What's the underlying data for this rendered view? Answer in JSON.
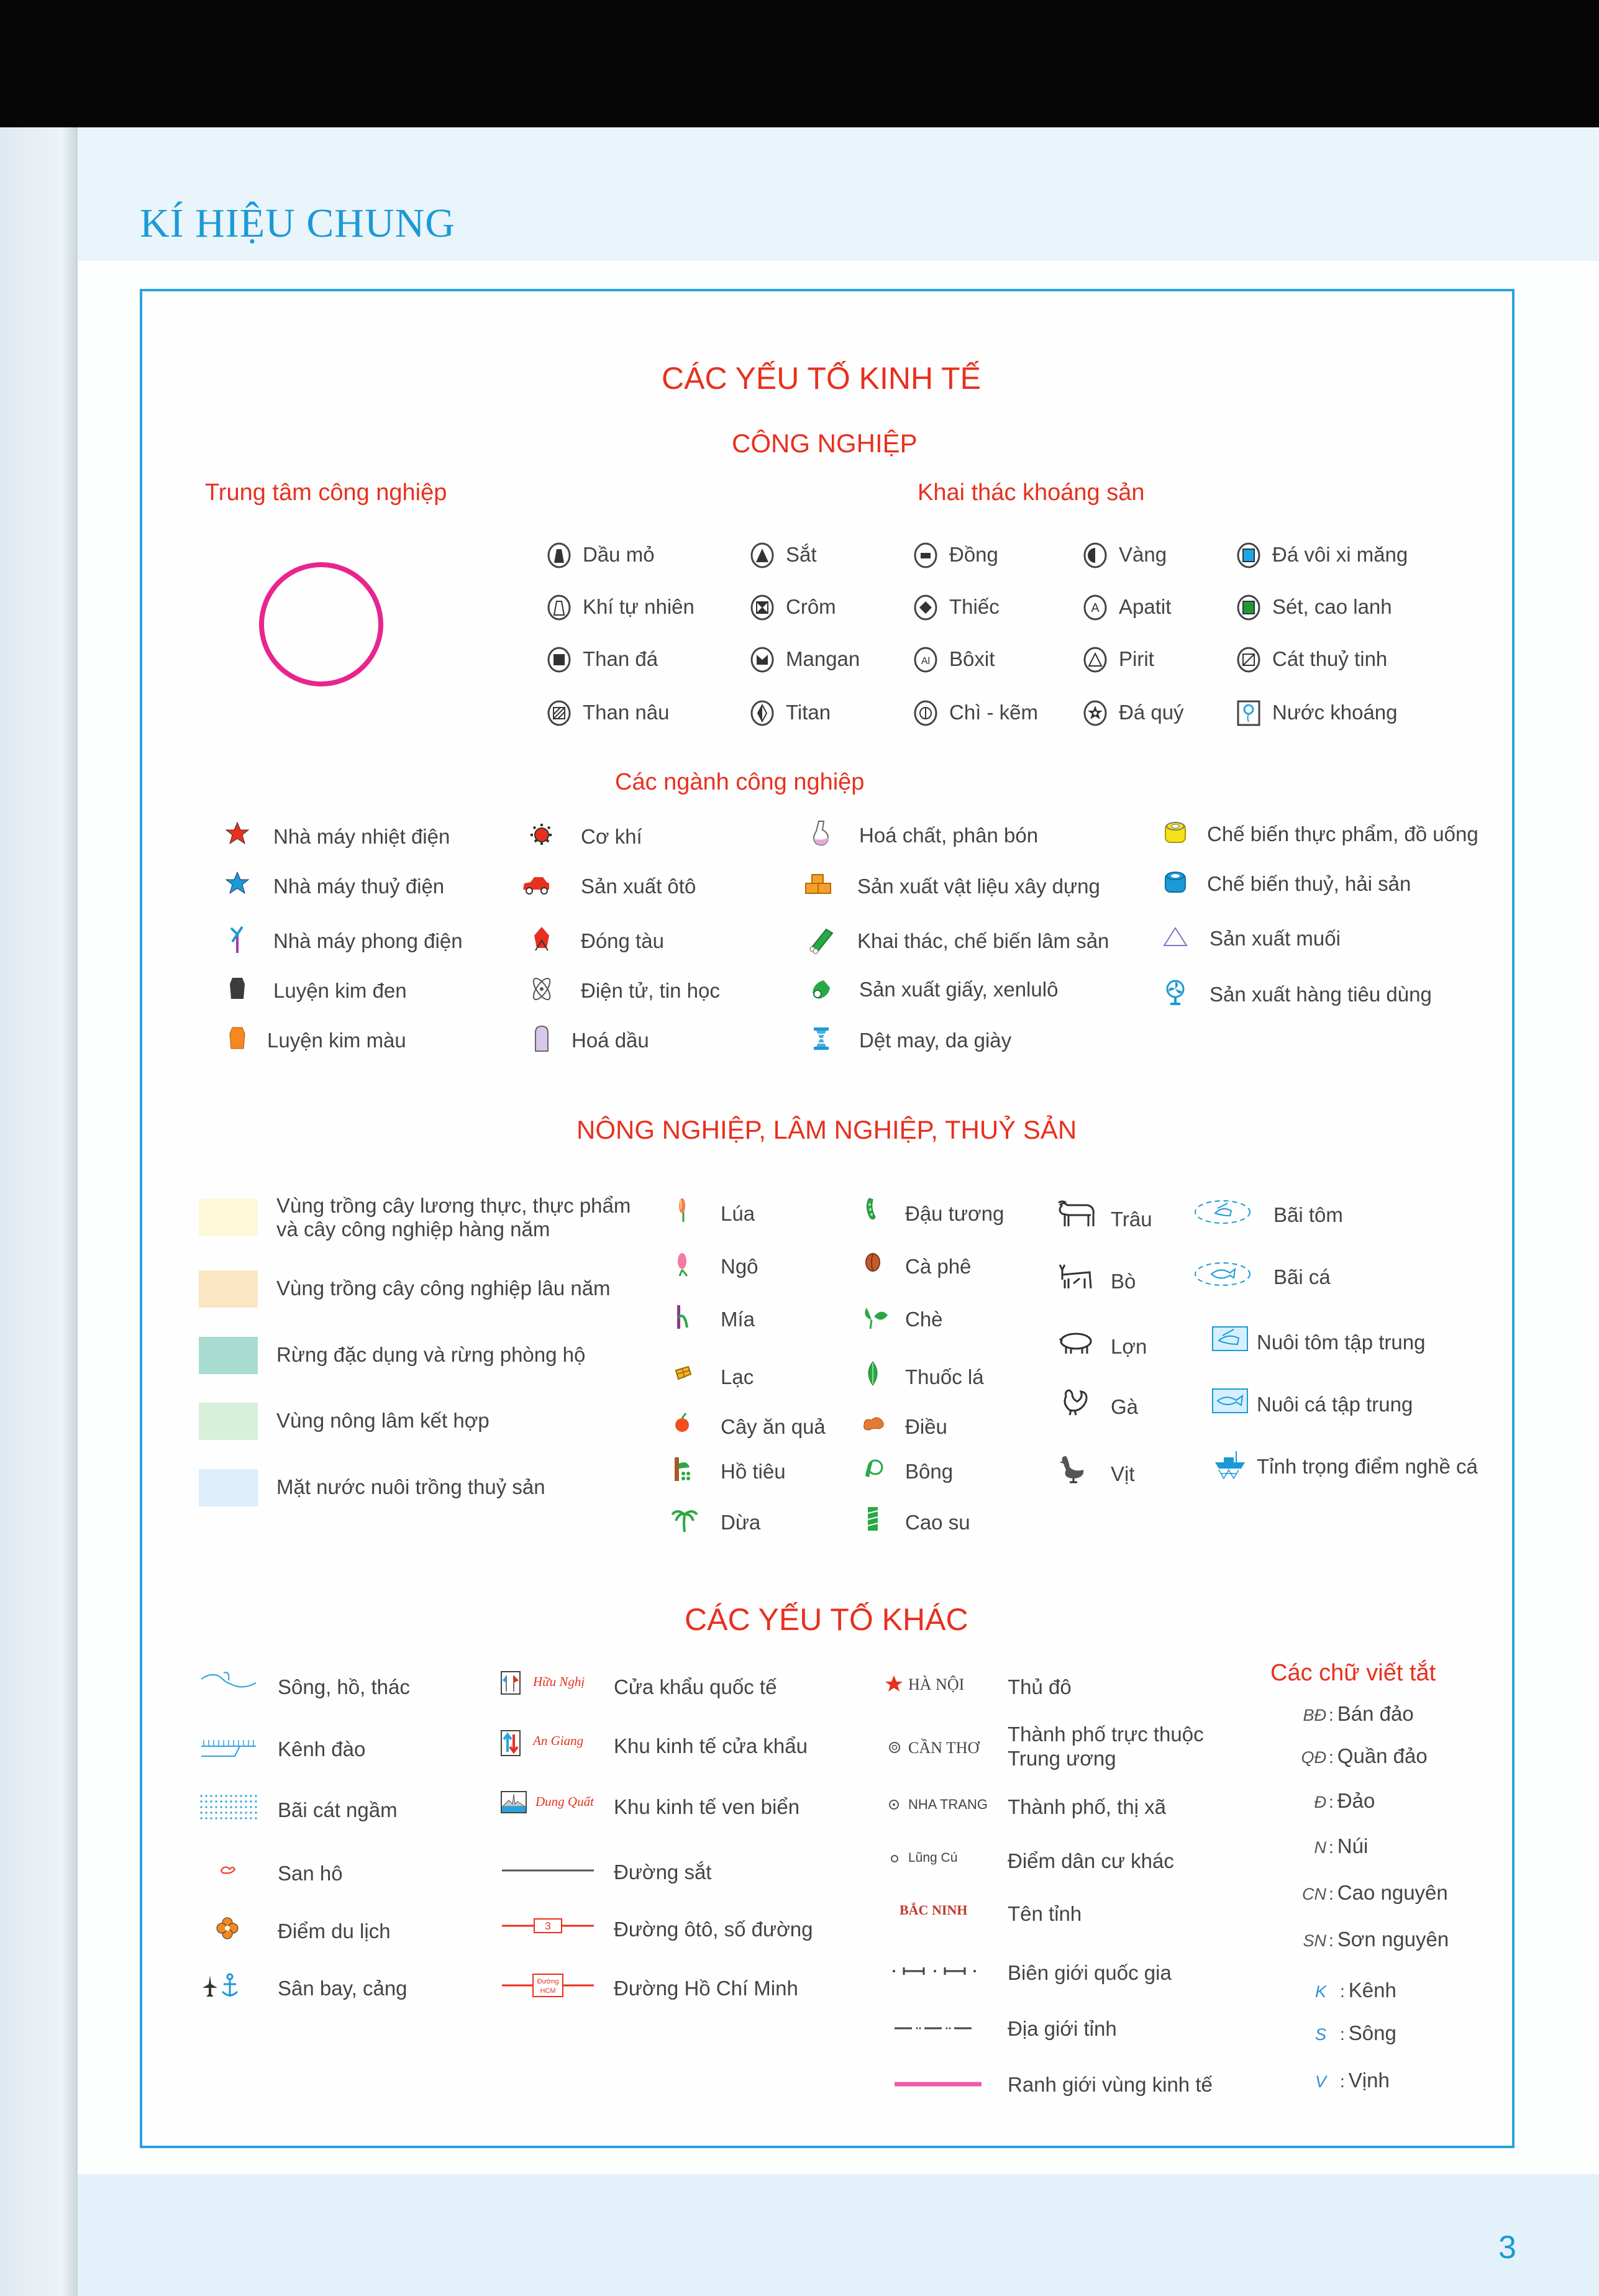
{
  "page": {
    "title": "KÍ HIỆU CHUNG",
    "page_number": "3"
  },
  "economy": {
    "heading": "CÁC YẾU TỐ KINH TẾ",
    "industry": {
      "heading": "CÔNG NGHIỆP",
      "center_label": "Trung tâm công nghiệp",
      "center_color": "#e8258f",
      "minerals_heading": "Khai thác khoáng sản",
      "minerals": [
        {
          "label": "Dầu mỏ",
          "icon": "oil-icon"
        },
        {
          "label": "Khí tự nhiên",
          "icon": "natural-gas-icon"
        },
        {
          "label": "Than đá",
          "icon": "coal-icon"
        },
        {
          "label": "Than nâu",
          "icon": "lignite-icon"
        },
        {
          "label": "Sắt",
          "icon": "iron-icon"
        },
        {
          "label": "Crôm",
          "icon": "chromium-icon"
        },
        {
          "label": "Mangan",
          "icon": "manganese-icon"
        },
        {
          "label": "Titan",
          "icon": "titanium-icon"
        },
        {
          "label": "Đồng",
          "icon": "copper-icon"
        },
        {
          "label": "Thiếc",
          "icon": "tin-icon"
        },
        {
          "label": "Bôxit",
          "icon": "bauxite-icon",
          "glyph": "Al"
        },
        {
          "label": "Chì - kẽm",
          "icon": "lead-zinc-icon"
        },
        {
          "label": "Vàng",
          "icon": "gold-icon"
        },
        {
          "label": "Apatit",
          "icon": "apatite-icon",
          "glyph": "A"
        },
        {
          "label": "Pirit",
          "icon": "pyrite-icon"
        },
        {
          "label": "Đá quý",
          "icon": "gemstone-icon"
        },
        {
          "label": "Đá vôi xi măng",
          "icon": "limestone-icon",
          "color": "#1aa7e6"
        },
        {
          "label": "Sét, cao lanh",
          "icon": "clay-kaolin-icon",
          "color": "#1e9a3a"
        },
        {
          "label": "Cát thuỷ tinh",
          "icon": "glass-sand-icon"
        },
        {
          "label": "Nước khoáng",
          "icon": "mineral-water-icon"
        }
      ],
      "sectors_heading": "Các ngành công nghiệp",
      "sectors": [
        {
          "label": "Nhà máy nhiệt điện",
          "icon": "thermal-power-icon",
          "color": "#e8301e"
        },
        {
          "label": "Nhà máy thuỷ điện",
          "icon": "hydro-power-icon",
          "color": "#1a9ad6"
        },
        {
          "label": "Nhà máy phong điện",
          "icon": "wind-power-icon",
          "color": "#a43ba0"
        },
        {
          "label": "Luyện kim đen",
          "icon": "ferrous-metallurgy-icon",
          "color": "#3c3c3c"
        },
        {
          "label": "Luyện kim màu",
          "icon": "nonferrous-metallurgy-icon",
          "color": "#f5881f"
        },
        {
          "label": "Cơ khí",
          "icon": "mechanical-icon",
          "color": "#e8301e"
        },
        {
          "label": "Sản xuất ôtô",
          "icon": "car-icon",
          "color": "#e8301e"
        },
        {
          "label": "Đóng tàu",
          "icon": "shipbuilding-icon",
          "color": "#e8301e"
        },
        {
          "label": "Điện tử, tin học",
          "icon": "electronics-icon",
          "color": "#555555"
        },
        {
          "label": "Hoá dầu",
          "icon": "petrochemical-icon",
          "color": "#d9c7ec"
        },
        {
          "label": "Hoá chất, phân bón",
          "icon": "chemical-flask-icon",
          "color": "#e6a9dd"
        },
        {
          "label": "Sản xuất vật liệu xây dựng",
          "icon": "bricks-icon",
          "color": "#f5a02c"
        },
        {
          "label": "Khai thác, chế biến lâm sản",
          "icon": "timber-icon",
          "color": "#2aa845"
        },
        {
          "label": "Sản xuất giấy, xenlulô",
          "icon": "paper-roll-icon",
          "color": "#2aa845"
        },
        {
          "label": "Dệt may, da giày",
          "icon": "textile-spool-icon",
          "color": "#1a9ad6"
        },
        {
          "label": "Chế biến thực phẩm, đồ uống",
          "icon": "food-can-icon",
          "color": "#f4e21a"
        },
        {
          "label": "Chế biến thuỷ, hải sản",
          "icon": "seafood-can-icon",
          "color": "#1a9ad6"
        },
        {
          "label": "Sản xuất muối",
          "icon": "salt-triangle-icon",
          "color": "#8a70c8"
        },
        {
          "label": "Sản xuất hàng tiêu dùng",
          "icon": "fan-icon",
          "color": "#1a9ad6"
        }
      ]
    },
    "agriculture": {
      "heading": "NÔNG NGHIỆP, LÂM NGHIỆP, THUỶ SẢN",
      "zones": [
        {
          "label_line1": "Vùng trồng cây lương thực, thực phẩm",
          "label_line2": "và cây công nghiệp hàng năm",
          "color": "#fdf8d8"
        },
        {
          "label_line1": "Vùng trồng cây công nghiệp lâu năm",
          "label_line2": "",
          "color": "#fbe6c4"
        },
        {
          "label_line1": "Rừng đặc dụng và rừng phòng hộ",
          "label_line2": "",
          "color": "#a9dcd0"
        },
        {
          "label_line1": "Vùng nông lâm kết hợp",
          "label_line2": "",
          "color": "#d7f0da"
        },
        {
          "label_line1": "Mặt nước nuôi trồng thuỷ sản",
          "label_line2": "",
          "color": "#dcedfb"
        }
      ],
      "crops_col1": [
        {
          "label": "Lúa",
          "icon": "rice-icon"
        },
        {
          "label": "Ngô",
          "icon": "corn-icon"
        },
        {
          "label": "Mía",
          "icon": "sugarcane-icon"
        },
        {
          "label": "Lạc",
          "icon": "peanut-icon"
        },
        {
          "label": "Cây ăn quả",
          "icon": "fruit-icon"
        },
        {
          "label": "Hồ tiêu",
          "icon": "pepper-icon"
        },
        {
          "label": "Dừa",
          "icon": "coconut-palm-icon"
        }
      ],
      "crops_col2": [
        {
          "label": "Đậu tương",
          "icon": "soybean-icon"
        },
        {
          "label": "Cà phê",
          "icon": "coffee-bean-icon"
        },
        {
          "label": "Chè",
          "icon": "tea-leaf-icon"
        },
        {
          "label": "Thuốc lá",
          "icon": "tobacco-leaf-icon"
        },
        {
          "label": "Điều",
          "icon": "cashew-icon"
        },
        {
          "label": "Bông",
          "icon": "cotton-icon"
        },
        {
          "label": "Cao su",
          "icon": "rubber-tree-icon"
        }
      ],
      "livestock": [
        {
          "label": "Trâu",
          "icon": "buffalo-icon"
        },
        {
          "label": "Bò",
          "icon": "cow-icon"
        },
        {
          "label": "Lợn",
          "icon": "pig-icon"
        },
        {
          "label": "Gà",
          "icon": "chicken-icon"
        },
        {
          "label": "Vịt",
          "icon": "duck-icon"
        }
      ],
      "fisheries": [
        {
          "label": "Bãi tôm",
          "icon": "shrimp-ground-icon"
        },
        {
          "label": "Bãi cá",
          "icon": "fish-ground-icon"
        },
        {
          "label": "Nuôi tôm tập trung",
          "icon": "shrimp-farm-icon"
        },
        {
          "label": "Nuôi cá tập trung",
          "icon": "fish-farm-icon"
        },
        {
          "label": "Tỉnh trọng điểm nghề cá",
          "icon": "fishing-boat-icon"
        }
      ]
    }
  },
  "other": {
    "heading": "CÁC YẾU TỐ KHÁC",
    "col1": [
      {
        "label": "Sông, hồ, thác",
        "icon": "river-icon"
      },
      {
        "label": "Kênh đào",
        "icon": "canal-icon"
      },
      {
        "label": "Bãi cát ngầm",
        "icon": "sandbank-icon"
      },
      {
        "label": "San hô",
        "icon": "coral-icon"
      },
      {
        "label": "Điểm du lịch",
        "icon": "tourist-spot-icon"
      },
      {
        "label": "Sân bay, cảng",
        "icon": "airport-port-icon"
      }
    ],
    "col2": [
      {
        "label": "Cửa khẩu quốc tế",
        "sample": "Hữu Nghị",
        "icon": "border-gate-icon"
      },
      {
        "label": "Khu kinh tế cửa khẩu",
        "sample": "An Giang",
        "icon": "border-economic-zone-icon"
      },
      {
        "label": "Khu kinh tế ven biển",
        "sample": "Dung Quất",
        "icon": "coastal-economic-zone-icon"
      },
      {
        "label": "Đường sắt",
        "sample": "",
        "icon": "railway-line-icon"
      },
      {
        "label": "Đường ôtô, số đường",
        "sample": "3",
        "icon": "road-line-icon"
      },
      {
        "label": "Đường Hồ Chí Minh",
        "sample_line1": "Đường",
        "sample_line2": "HCM",
        "icon": "hcm-road-icon"
      }
    ],
    "col3": [
      {
        "label": "Thủ đô",
        "sample": "HÀ NỘI",
        "icon": "capital-star-icon"
      },
      {
        "label_line1": "Thành phố trực thuộc",
        "label_line2": "Trung ương",
        "sample": "CẦN THƠ",
        "icon": "central-city-icon"
      },
      {
        "label": "Thành phố, thị xã",
        "sample": "NHA TRANG",
        "icon": "city-icon"
      },
      {
        "label": "Điểm dân cư khác",
        "sample": "Lũng Cú",
        "icon": "settlement-icon"
      },
      {
        "label": "Tên tỉnh",
        "sample": "BẮC NINH",
        "icon": "province-name-icon"
      },
      {
        "label": "Biên giới quốc gia",
        "icon": "national-border-icon"
      },
      {
        "label": "Địa giới tỉnh",
        "icon": "province-boundary-icon"
      },
      {
        "label": "Ranh giới vùng kinh tế",
        "icon": "economic-region-boundary-icon",
        "color": "#ee5aa8"
      }
    ],
    "abbreviations": {
      "heading": "Các chữ viết tắt",
      "items": [
        {
          "key": "BĐ",
          "sep": ":",
          "value": "Bán đảo"
        },
        {
          "key": "QĐ",
          "sep": ":",
          "value": "Quần đảo"
        },
        {
          "key": "Đ",
          "sep": ":",
          "value": "Đảo"
        },
        {
          "key": "N",
          "sep": ":",
          "value": "Núi"
        },
        {
          "key": "CN",
          "sep": ":",
          "value": "Cao nguyên"
        },
        {
          "key": "SN",
          "sep": ":",
          "value": "Sơn nguyên"
        },
        {
          "key": "K",
          "sep": ":",
          "value": "Kênh"
        },
        {
          "key": "S",
          "sep": ":",
          "value": "Sông"
        },
        {
          "key": "V",
          "sep": ":",
          "value": "Vịnh"
        }
      ]
    }
  }
}
